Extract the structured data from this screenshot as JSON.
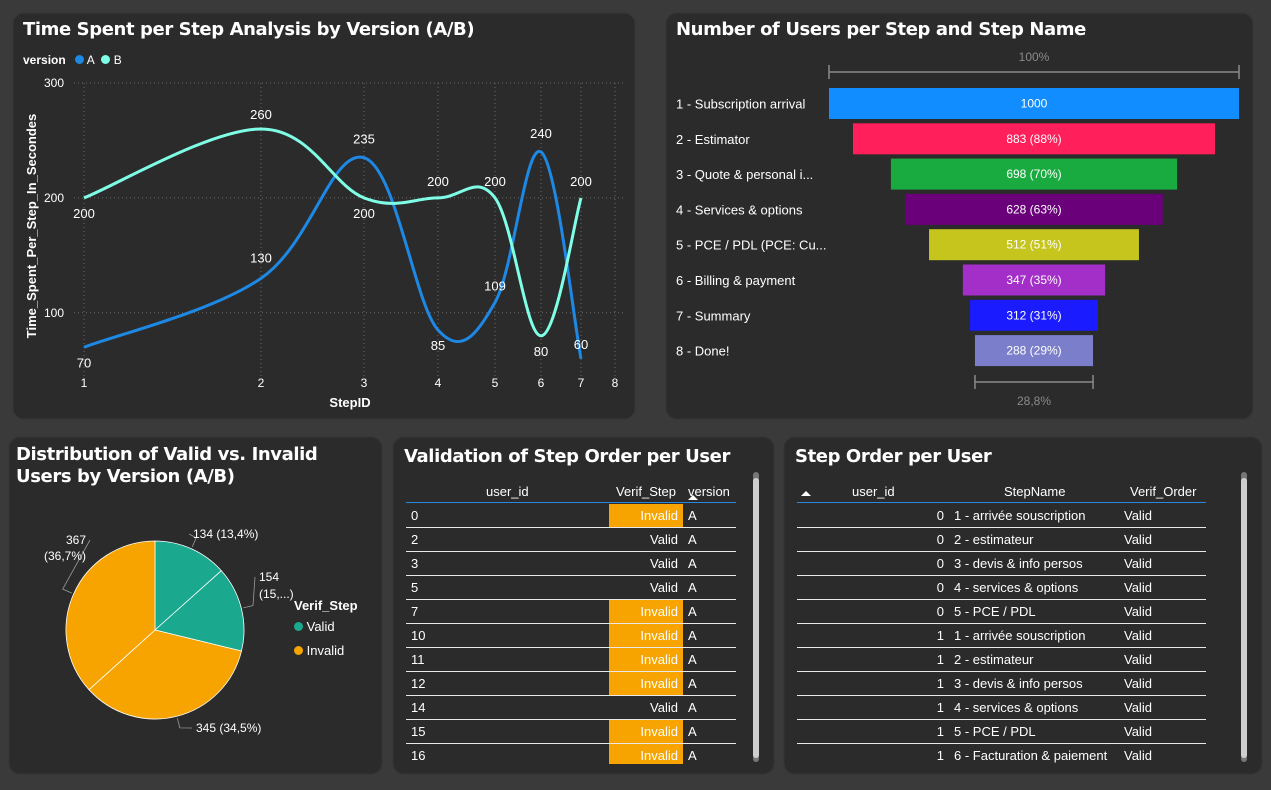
{
  "colors": {
    "series_a": "#1e88e5",
    "series_b": "#7fffe6",
    "valid": "#1aa98e",
    "invalid": "#f7a400",
    "invalid_cell": "#f7a400"
  },
  "line_panel": {
    "title": "Time Spent per Step Analysis by Version (A/B)",
    "legend_title": "version",
    "legend_a": "A",
    "legend_b": "B"
  },
  "funnel_panel": {
    "title": "Number of Users per Step and Step Name",
    "top_pct": "100%",
    "bottom_pct": "28,8%"
  },
  "pie_panel": {
    "title": "Distribution of Valid vs. Invalid Users by Version (A/B)",
    "legend_title": "Verif_Step",
    "legend_valid": "Valid",
    "legend_invalid": "Invalid"
  },
  "validation_panel": {
    "title": "Validation of Step Order per User",
    "columns": [
      "user_id",
      "Verif_Step",
      "version"
    ],
    "rows": [
      {
        "user_id": "0",
        "verif": "Invalid",
        "version": "A"
      },
      {
        "user_id": "2",
        "verif": "Valid",
        "version": "A"
      },
      {
        "user_id": "3",
        "verif": "Valid",
        "version": "A"
      },
      {
        "user_id": "5",
        "verif": "Valid",
        "version": "A"
      },
      {
        "user_id": "7",
        "verif": "Invalid",
        "version": "A"
      },
      {
        "user_id": "10",
        "verif": "Invalid",
        "version": "A"
      },
      {
        "user_id": "11",
        "verif": "Invalid",
        "version": "A"
      },
      {
        "user_id": "12",
        "verif": "Invalid",
        "version": "A"
      },
      {
        "user_id": "14",
        "verif": "Valid",
        "version": "A"
      },
      {
        "user_id": "15",
        "verif": "Invalid",
        "version": "A"
      },
      {
        "user_id": "16",
        "verif": "Invalid",
        "version": "A"
      }
    ]
  },
  "order_panel": {
    "title": "Step Order per User",
    "columns": [
      "user_id",
      "StepName",
      "Verif_Order"
    ],
    "rows": [
      {
        "user_id": "0",
        "step": "1 - arrivée souscription",
        "verif": "Valid"
      },
      {
        "user_id": "0",
        "step": "2 - estimateur",
        "verif": "Valid"
      },
      {
        "user_id": "0",
        "step": "3 - devis & info persos",
        "verif": "Valid"
      },
      {
        "user_id": "0",
        "step": "4 - services & options",
        "verif": "Valid"
      },
      {
        "user_id": "0",
        "step": "5 - PCE / PDL",
        "verif": "Valid"
      },
      {
        "user_id": "1",
        "step": "1 - arrivée souscription",
        "verif": "Valid"
      },
      {
        "user_id": "1",
        "step": "2 - estimateur",
        "verif": "Valid"
      },
      {
        "user_id": "1",
        "step": "3 - devis & info persos",
        "verif": "Valid"
      },
      {
        "user_id": "1",
        "step": "4 - services & options",
        "verif": "Valid"
      },
      {
        "user_id": "1",
        "step": "5 - PCE / PDL",
        "verif": "Valid"
      },
      {
        "user_id": "1",
        "step": "6 - Facturation & paiement",
        "verif": "Valid"
      }
    ]
  },
  "chart_data": [
    {
      "type": "line",
      "title": "Time Spent per Step Analysis by Version (A/B)",
      "xlabel": "StepID",
      "ylabel": "Time_Spent_Per_Step_In_Secondes",
      "x_ticks": [
        "1",
        "2",
        "3",
        "4",
        "5",
        "6",
        "7",
        "8"
      ],
      "y_ticks": [
        "100",
        "200",
        "300"
      ],
      "xlim": [
        1,
        8
      ],
      "ylim": [
        45,
        300
      ],
      "grid": true,
      "legend": "top-left",
      "series": [
        {
          "name": "A",
          "x": [
            1,
            2,
            3,
            4,
            5,
            6,
            7
          ],
          "values": [
            70,
            130,
            235,
            85,
            109,
            240,
            60
          ]
        },
        {
          "name": "B",
          "x": [
            1,
            2,
            3,
            4,
            5,
            6,
            7
          ],
          "values": [
            200,
            260,
            200,
            200,
            200,
            80,
            200
          ]
        }
      ]
    },
    {
      "type": "bar",
      "title": "Number of Users per Step and Step Name",
      "categories": [
        "1 - Subscription arrival",
        "2 - Estimator",
        "3 - Quote & personal i...",
        "4 - Services & options",
        "5 - PCE / PDL (PCE: Cu...",
        "6 - Billing & payment",
        "7 - Summary",
        "8 - Done!"
      ],
      "values": [
        1000,
        883,
        698,
        628,
        512,
        347,
        312,
        288
      ],
      "labels": [
        "1000",
        "883 (88%)",
        "698 (70%)",
        "628 (63%)",
        "512 (51%)",
        "347 (35%)",
        "312 (31%)",
        "288 (29%)"
      ],
      "colors": [
        "#118dff",
        "#ff1f5a",
        "#1aab40",
        "#6b007b",
        "#c5c51e",
        "#a42ec8",
        "#1b1bff",
        "#7b7fcb"
      ]
    },
    {
      "type": "pie",
      "title": "Distribution of Valid vs. Invalid Users by Version (A/B)",
      "slices": [
        {
          "category": "Valid",
          "value": 134,
          "label": "134 (13,4%)"
        },
        {
          "category": "Valid",
          "value": 154,
          "label": "154 (15,...)"
        },
        {
          "category": "Invalid",
          "value": 345,
          "label": "345 (34,5%)"
        },
        {
          "category": "Invalid",
          "value": 367,
          "label": "367 (36,7%)"
        }
      ],
      "legend": "right"
    }
  ]
}
